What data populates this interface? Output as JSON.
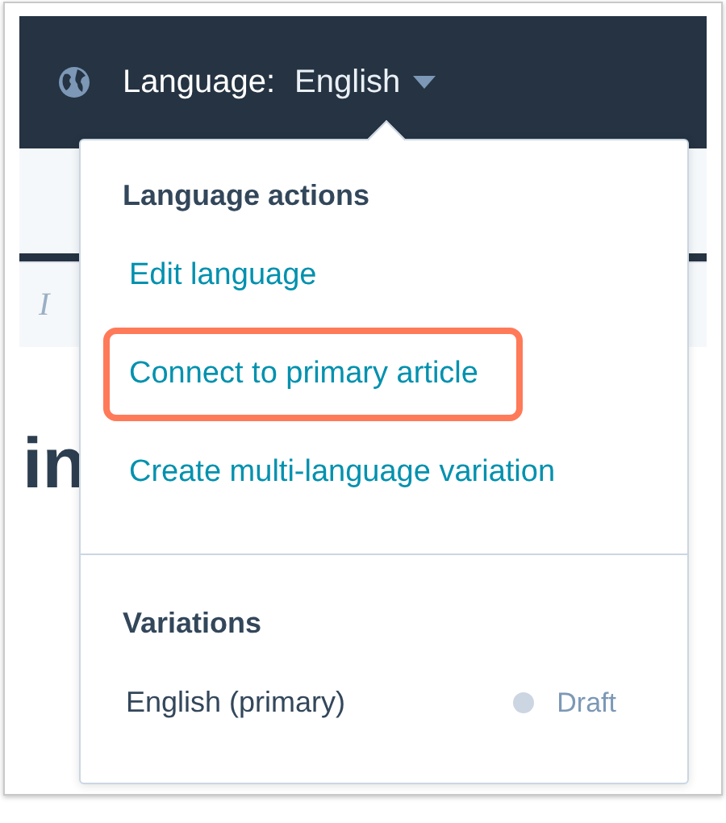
{
  "header": {
    "label": "Language:",
    "value": "English"
  },
  "background": {
    "toolbar_italic": "I",
    "heading_fragment": "in"
  },
  "menu": {
    "heading": "Language actions",
    "actions": [
      {
        "label": "Edit language",
        "highlighted": false
      },
      {
        "label": "Connect to primary article",
        "highlighted": true
      },
      {
        "label": "Create multi-language variation",
        "highlighted": false
      }
    ],
    "variations_heading": "Variations",
    "variations": [
      {
        "name": "English (primary)",
        "status": "Draft",
        "color": "#cbd6e2"
      }
    ]
  }
}
